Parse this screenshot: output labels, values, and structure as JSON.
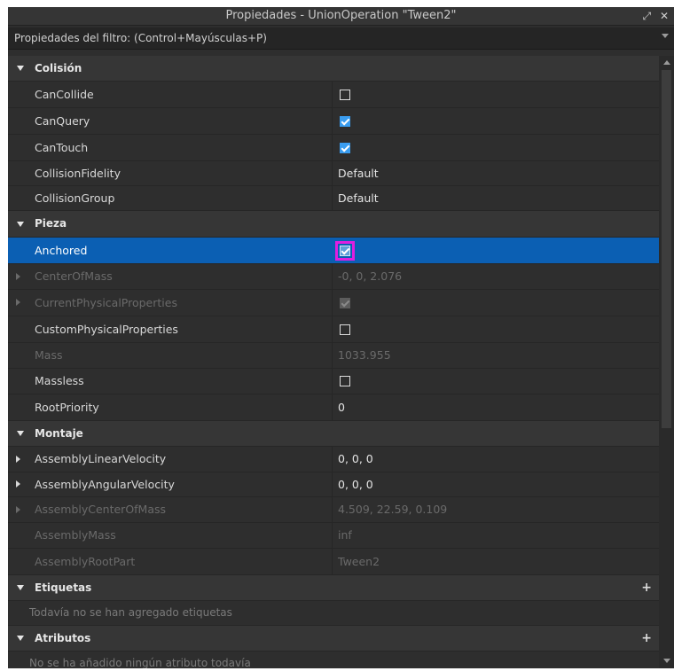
{
  "window": {
    "title": "Propiedades - UnionOperation \"Tween2\"",
    "popout_icon": "popout-icon",
    "close_icon": "close-icon"
  },
  "filter": {
    "placeholder": "Propiedades del filtro: (Control+Mayúsculas+P)"
  },
  "categories": {
    "colision": "Colisión",
    "pieza": "Pieza",
    "montaje": "Montaje",
    "etiquetas": "Etiquetas",
    "atributos": "Atributos"
  },
  "props": {
    "cancollide": {
      "name": "CanCollide",
      "checked": false
    },
    "canquery": {
      "name": "CanQuery",
      "checked": true
    },
    "cantouch": {
      "name": "CanTouch",
      "checked": true
    },
    "collisionfidelity": {
      "name": "CollisionFidelity",
      "value": "Default"
    },
    "collisiongroup": {
      "name": "CollisionGroup",
      "value": "Default"
    },
    "anchored": {
      "name": "Anchored",
      "checked": true
    },
    "centerofmass": {
      "name": "CenterOfMass",
      "value": "-0, 0, 2.076"
    },
    "currentphysical": {
      "name": "CurrentPhysicalProperties",
      "checked": true
    },
    "customphysical": {
      "name": "CustomPhysicalProperties",
      "checked": false
    },
    "mass": {
      "name": "Mass",
      "value": "1033.955"
    },
    "massless": {
      "name": "Massless",
      "checked": false
    },
    "rootpriority": {
      "name": "RootPriority",
      "value": "0"
    },
    "linearvel": {
      "name": "AssemblyLinearVelocity",
      "value": "0, 0, 0"
    },
    "angularvel": {
      "name": "AssemblyAngularVelocity",
      "value": "0, 0, 0"
    },
    "centerofmass2": {
      "name": "AssemblyCenterOfMass",
      "value": "4.509, 22.59, 0.109"
    },
    "assemblymass": {
      "name": "AssemblyMass",
      "value": "inf"
    },
    "rootpart": {
      "name": "AssemblyRootPart",
      "value": "Tween2"
    }
  },
  "etiquetas_empty": "Todavía no se han agregado etiquetas",
  "atributos_empty": "No se ha añadido ningún atributo todavía",
  "plus_label": "+",
  "accent": "#0b5fb3",
  "highlight": "#e01ee0"
}
